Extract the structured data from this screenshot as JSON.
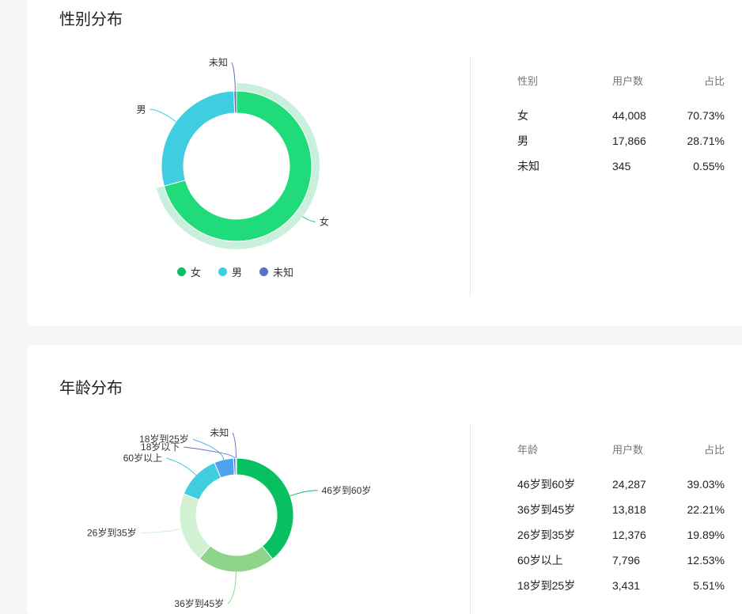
{
  "gender_section": {
    "title": "性别分布",
    "table": {
      "headers": [
        "性别",
        "用户数",
        "占比"
      ],
      "rows": [
        [
          "女",
          "44,008",
          "70.73%"
        ],
        [
          "男",
          "17,866",
          "28.71%"
        ],
        [
          "未知",
          "345",
          "0.55%"
        ]
      ]
    },
    "legend": [
      {
        "label": "女",
        "color": "#07c160"
      },
      {
        "label": "男",
        "color": "#3fcde0"
      },
      {
        "label": "未知",
        "color": "#5b6fc8"
      }
    ]
  },
  "age_section": {
    "title": "年龄分布",
    "table": {
      "headers": [
        "年龄",
        "用户数",
        "占比"
      ],
      "rows": [
        [
          "46岁到60岁",
          "24,287",
          "39.03%"
        ],
        [
          "36岁到45岁",
          "13,818",
          "22.21%"
        ],
        [
          "26岁到35岁",
          "12,376",
          "19.89%"
        ],
        [
          "60岁以上",
          "7,796",
          "12.53%"
        ],
        [
          "18岁到25岁",
          "3,431",
          "5.51%"
        ]
      ]
    }
  },
  "chart_data": [
    {
      "type": "pie",
      "variant": "donut",
      "title": "性别分布",
      "categories": [
        "女",
        "男",
        "未知"
      ],
      "values": [
        70.73,
        28.71,
        0.55
      ],
      "colors": [
        "#1fdb7a",
        "#3fcde0",
        "#5b6fc8"
      ],
      "legend_position": "bottom"
    },
    {
      "type": "pie",
      "variant": "donut",
      "title": "年龄分布",
      "categories": [
        "46岁到60岁",
        "36岁到45岁",
        "26岁到35岁",
        "60岁以上",
        "18岁到25岁",
        "18岁以下",
        "未知"
      ],
      "values": [
        39.03,
        22.21,
        19.89,
        12.53,
        5.51,
        0.6,
        0.23
      ],
      "colors": [
        "#07c160",
        "#8ed58b",
        "#d2f0d2",
        "#3fcde0",
        "#4ea3ee",
        "#5b6fc8",
        "#7a6fd0"
      ]
    }
  ]
}
